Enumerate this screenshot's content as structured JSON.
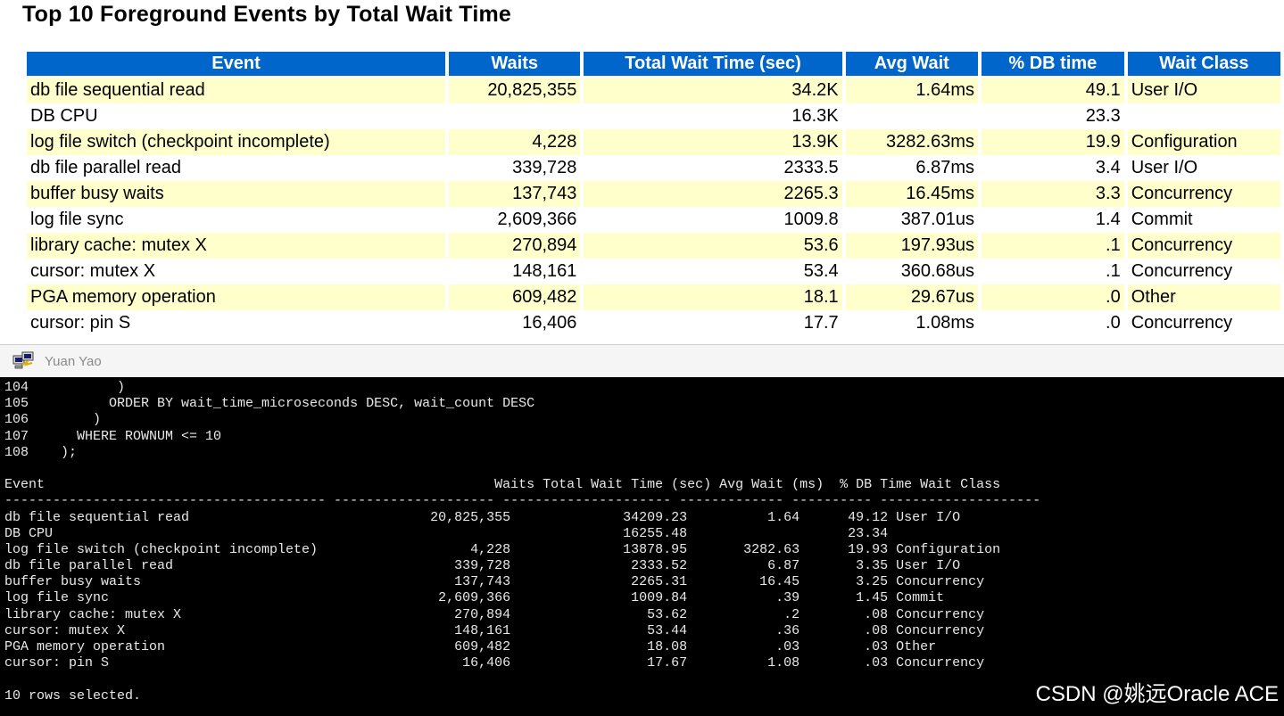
{
  "report": {
    "title": "Top 10 Foreground Events by Total Wait Time",
    "columns": [
      "Event",
      "Waits",
      "Total Wait Time (sec)",
      "Avg Wait",
      "% DB time",
      "Wait Class"
    ],
    "rows": [
      [
        "db file sequential read",
        "20,825,355",
        "34.2K",
        "1.64ms",
        "49.1",
        "User I/O"
      ],
      [
        "DB CPU",
        "",
        "16.3K",
        "",
        "23.3",
        ""
      ],
      [
        "log file switch (checkpoint incomplete)",
        "4,228",
        "13.9K",
        "3282.63ms",
        "19.9",
        "Configuration"
      ],
      [
        "db file parallel read",
        "339,728",
        "2333.5",
        "6.87ms",
        "3.4",
        "User I/O"
      ],
      [
        "buffer busy waits",
        "137,743",
        "2265.3",
        "16.45ms",
        "3.3",
        "Concurrency"
      ],
      [
        "log file sync",
        "2,609,366",
        "1009.8",
        "387.01us",
        "1.4",
        "Commit"
      ],
      [
        "library cache: mutex X",
        "270,894",
        "53.6",
        "197.93us",
        ".1",
        "Concurrency"
      ],
      [
        "cursor: mutex X",
        "148,161",
        "53.4",
        "360.68us",
        ".1",
        "Concurrency"
      ],
      [
        "PGA memory operation",
        "609,482",
        "18.1",
        "29.67us",
        ".0",
        "Other"
      ],
      [
        "cursor: pin S",
        "16,406",
        "17.7",
        "1.08ms",
        ".0",
        "Concurrency"
      ]
    ]
  },
  "terminal_window": {
    "title": "Yuan Yao",
    "icon": "putty-terminal-icon",
    "lines": [
      "104           )",
      "105          ORDER BY wait_time_microseconds DESC, wait_count DESC",
      "106        )",
      "107      WHERE ROWNUM <= 10",
      "108    );",
      "",
      "Event                                                        Waits Total Wait Time (sec) Avg Wait (ms)  % DB Time Wait Class",
      "---------------------------------------- -------------------- --------------------- ------------- ---------- --------------------",
      "db file sequential read                              20,825,355              34209.23          1.64      49.12 User I/O",
      "DB CPU                                                                       16255.48                    23.34",
      "log file switch (checkpoint incomplete)                   4,228              13878.95       3282.63      19.93 Configuration",
      "db file parallel read                                   339,728               2333.52          6.87       3.35 User I/O",
      "buffer busy waits                                       137,743               2265.31         16.45       3.25 Concurrency",
      "log file sync                                         2,609,366               1009.84           .39       1.45 Commit",
      "library cache: mutex X                                  270,894                 53.62            .2        .08 Concurrency",
      "cursor: mutex X                                         148,161                 53.44           .36        .08 Concurrency",
      "PGA memory operation                                    609,482                 18.08           .03        .03 Other",
      "cursor: pin S                                            16,406                 17.67          1.08        .03 Concurrency",
      "",
      "10 rows selected."
    ],
    "watermark": "CSDN @姚远Oracle ACE"
  },
  "colors": {
    "header_bg": "#0066cc",
    "alt_row_bg": "#ffffcc",
    "terminal_bg": "#000000",
    "terminal_fg": "#e8e8e8"
  }
}
